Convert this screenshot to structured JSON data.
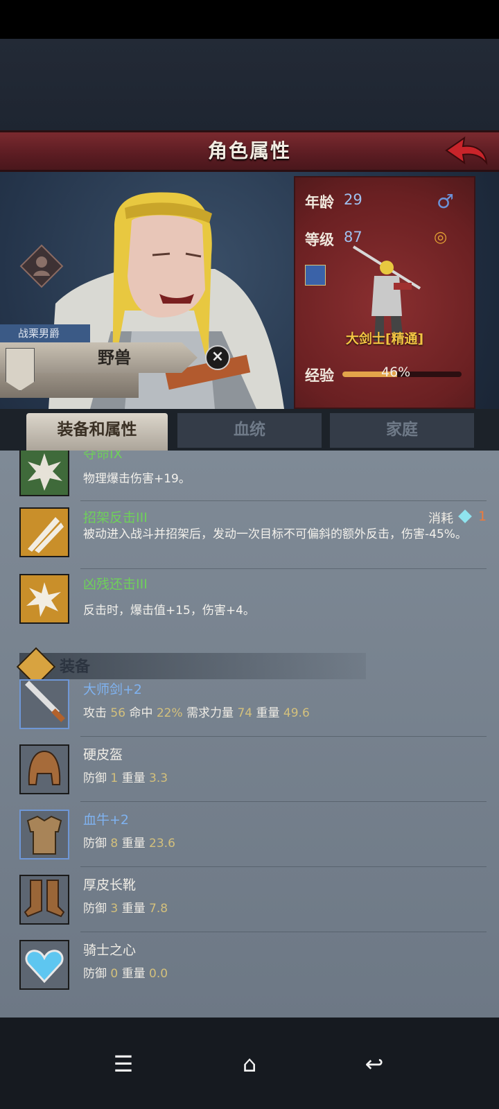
{
  "header": {
    "title": "角色属性"
  },
  "character": {
    "title": "战栗男爵",
    "name": "野兽",
    "age_label": "年龄",
    "age": "29",
    "level_label": "等级",
    "level": "87",
    "class_name": "大剑士[精通]",
    "exp_label": "经验",
    "exp_value": "46%",
    "exp_fraction": 0.46
  },
  "tabs": {
    "equip": "装备和属性",
    "bloodline": "血统",
    "family": "家庭"
  },
  "skills": [
    {
      "name": "夺命IX",
      "desc": "物理爆击伤害+19。",
      "color": "#6fd05a"
    },
    {
      "name": "招架反击III",
      "desc": "被动进入战斗并招架后，发动一次目标不可偏斜的额外反击，伤害-45%。",
      "color": "#6fd05a"
    },
    {
      "name": "凶残还击III",
      "desc": "反击时，爆击值+15，伤害+4。",
      "color": "#6fd05a"
    }
  ],
  "cost": {
    "label": "消耗",
    "amount": "1"
  },
  "equipment_header": "装备",
  "equipment": [
    {
      "name": "大师剑+2",
      "stats": [
        [
          "攻击",
          "56"
        ],
        [
          "命中",
          "22%"
        ],
        [
          "需求力量",
          "74"
        ],
        [
          "重量",
          "49.6"
        ]
      ]
    },
    {
      "name": "硬皮盔",
      "stats": [
        [
          "防御",
          "1"
        ],
        [
          "重量",
          "3.3"
        ]
      ]
    },
    {
      "name": "血牛+2",
      "stats": [
        [
          "防御",
          "8"
        ],
        [
          "重量",
          "23.6"
        ]
      ]
    },
    {
      "name": "厚皮长靴",
      "stats": [
        [
          "防御",
          "3"
        ],
        [
          "重量",
          "7.8"
        ]
      ]
    },
    {
      "name": "骑士之心",
      "stats": [
        [
          "防御",
          "0"
        ],
        [
          "重量",
          "0.0"
        ]
      ]
    }
  ]
}
